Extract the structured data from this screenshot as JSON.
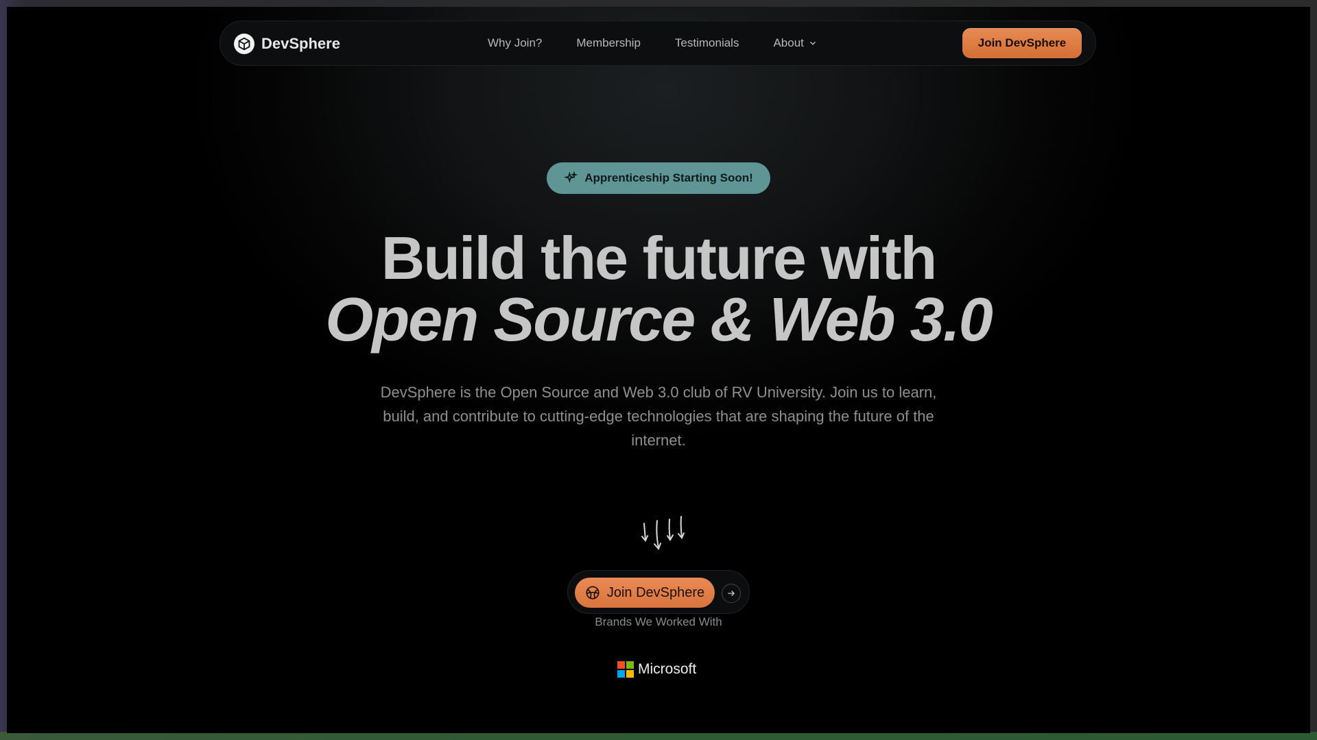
{
  "nav": {
    "brand": "DevSphere",
    "links": [
      "Why Join?",
      "Membership",
      "Testimonials",
      "About"
    ],
    "cta": "Join DevSphere"
  },
  "hero": {
    "badge": "Apprenticeship Starting Soon!",
    "headline_line1": "Build the future with",
    "headline_line2": "Open Source & Web 3.0",
    "subtitle": "DevSphere is the Open Source and Web 3.0 club of RV University. Join us to learn, build, and contribute to cutting-edge technologies that are shaping the future of the internet.",
    "cta": "Join DevSphere",
    "brands_label": "Brands We Worked With",
    "brand_logo": "Microsoft"
  },
  "colors": {
    "accent": "#e07f48",
    "badge": "#5f9595",
    "background": "#000000"
  },
  "icons": [
    "cube-logo-icon",
    "chevron-down-icon",
    "sparkle-icon",
    "hand-drawn-arrows-icon",
    "globe-icon",
    "arrow-right-icon",
    "microsoft-logo-icon"
  ]
}
